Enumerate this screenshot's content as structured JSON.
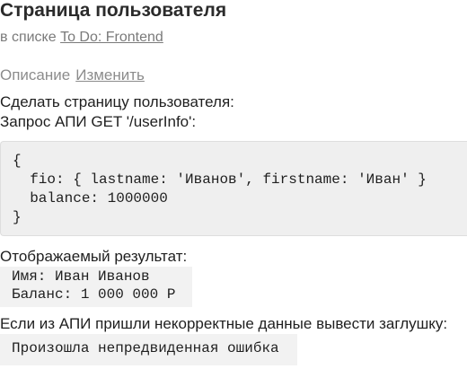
{
  "card": {
    "title": "Страница пользователя",
    "in_list_prefix": "в списке",
    "list_name": "To Do: Frontend"
  },
  "description": {
    "label": "Описание",
    "edit_label": "Изменить",
    "line1": "Сделать страницу пользователя:",
    "line2": "Запрос АПИ GET '/userInfo':",
    "code_lines": [
      "{",
      "  fio: { lastname: 'Иванов', firstname: 'Иван' }",
      "  balance: 1000000",
      "}"
    ],
    "result_label": "Отображаемый результат:",
    "result_lines": [
      "Имя: Иван Иванов",
      "Баланс: 1 000 000 Р"
    ],
    "error_label": "Если из АПИ пришли некорректные данные вывести заглушку:",
    "error_placeholder": "Произошла непредвиденная ошибка"
  }
}
